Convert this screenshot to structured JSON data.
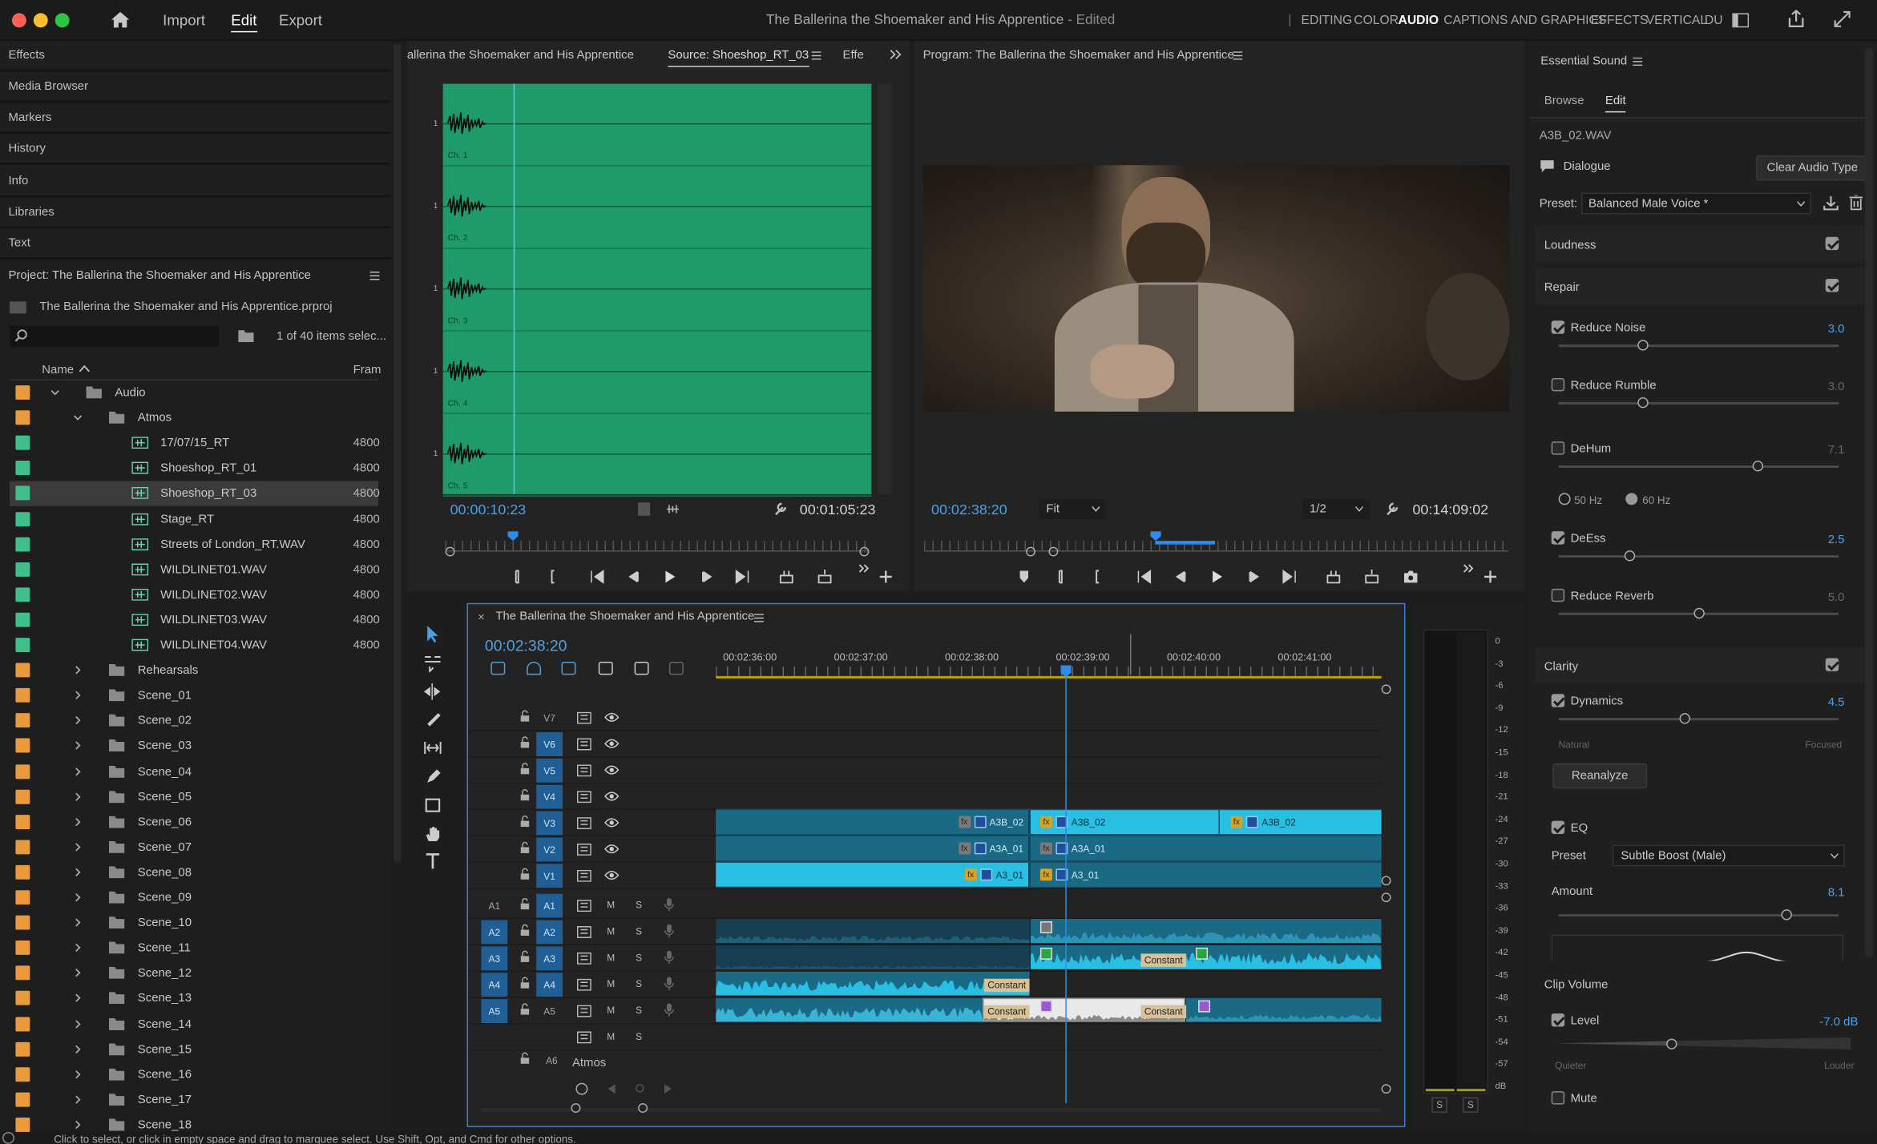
{
  "titlebar": {
    "home_icon": "home-icon",
    "menu": [
      "Import",
      "Edit",
      "Export"
    ],
    "active_menu": "Edit",
    "doc_title": "The Ballerina the Shoemaker and His Apprentice",
    "doc_status": "- Edited",
    "workspaces": [
      "EDITING",
      "COLOR",
      "AUDIO",
      "CAPTIONS AND GRAPHICS",
      "EFFECTS",
      "VERTICAL",
      "DU"
    ],
    "active_workspace": "AUDIO"
  },
  "left_tabs": [
    "Effects",
    "Media Browser",
    "Markers",
    "History",
    "Info",
    "Libraries",
    "Text"
  ],
  "project": {
    "title": "Project: The Ballerina the Shoemaker and His Apprentice",
    "file": "The Ballerina the Shoemaker and His Apprentice.prproj",
    "selection": "1 of 40 items selec...",
    "col_name": "Name",
    "col_frame": "Fram",
    "items": [
      {
        "label": "Audio",
        "type": "folder",
        "indent": 0,
        "open": true,
        "color": "#e89a3c",
        "rate": ""
      },
      {
        "label": "Atmos",
        "type": "folder",
        "indent": 1,
        "open": true,
        "color": "#e89a3c",
        "rate": ""
      },
      {
        "label": "17/07/15_RT",
        "type": "clip",
        "indent": 2,
        "color": "#3fc08a",
        "rate": "4800"
      },
      {
        "label": "Shoeshop_RT_01",
        "type": "clip",
        "indent": 2,
        "color": "#3fc08a",
        "rate": "4800"
      },
      {
        "label": "Shoeshop_RT_03",
        "type": "clip",
        "indent": 2,
        "color": "#3fc08a",
        "rate": "4800",
        "selected": true
      },
      {
        "label": "Stage_RT",
        "type": "clip",
        "indent": 2,
        "color": "#3fc08a",
        "rate": "4800"
      },
      {
        "label": "Streets of London_RT.WAV",
        "type": "clip",
        "indent": 2,
        "color": "#3fc08a",
        "rate": "4800"
      },
      {
        "label": "WILDLINET01.WAV",
        "type": "clip",
        "indent": 2,
        "color": "#3fc08a",
        "rate": "4800"
      },
      {
        "label": "WILDLINET02.WAV",
        "type": "clip",
        "indent": 2,
        "color": "#3fc08a",
        "rate": "4800"
      },
      {
        "label": "WILDLINET03.WAV",
        "type": "clip",
        "indent": 2,
        "color": "#3fc08a",
        "rate": "4800"
      },
      {
        "label": "WILDLINET04.WAV",
        "type": "clip",
        "indent": 2,
        "color": "#3fc08a",
        "rate": "4800"
      },
      {
        "label": "Rehearsals",
        "type": "folder",
        "indent": 1,
        "color": "#e89a3c",
        "rate": ""
      },
      {
        "label": "Scene_01",
        "type": "folder",
        "indent": 1,
        "color": "#e89a3c",
        "rate": ""
      },
      {
        "label": "Scene_02",
        "type": "folder",
        "indent": 1,
        "color": "#e89a3c",
        "rate": ""
      },
      {
        "label": "Scene_03",
        "type": "folder",
        "indent": 1,
        "color": "#e89a3c",
        "rate": ""
      },
      {
        "label": "Scene_04",
        "type": "folder",
        "indent": 1,
        "color": "#e89a3c",
        "rate": ""
      },
      {
        "label": "Scene_05",
        "type": "folder",
        "indent": 1,
        "color": "#e89a3c",
        "rate": ""
      },
      {
        "label": "Scene_06",
        "type": "folder",
        "indent": 1,
        "color": "#e89a3c",
        "rate": ""
      },
      {
        "label": "Scene_07",
        "type": "folder",
        "indent": 1,
        "color": "#e89a3c",
        "rate": ""
      },
      {
        "label": "Scene_08",
        "type": "folder",
        "indent": 1,
        "color": "#e89a3c",
        "rate": ""
      },
      {
        "label": "Scene_09",
        "type": "folder",
        "indent": 1,
        "color": "#e89a3c",
        "rate": ""
      },
      {
        "label": "Scene_10",
        "type": "folder",
        "indent": 1,
        "color": "#e89a3c",
        "rate": ""
      },
      {
        "label": "Scene_11",
        "type": "folder",
        "indent": 1,
        "color": "#e89a3c",
        "rate": ""
      },
      {
        "label": "Scene_12",
        "type": "folder",
        "indent": 1,
        "color": "#e89a3c",
        "rate": ""
      },
      {
        "label": "Scene_13",
        "type": "folder",
        "indent": 1,
        "color": "#e89a3c",
        "rate": ""
      },
      {
        "label": "Scene_14",
        "type": "folder",
        "indent": 1,
        "color": "#e89a3c",
        "rate": ""
      },
      {
        "label": "Scene_15",
        "type": "folder",
        "indent": 1,
        "color": "#e89a3c",
        "rate": ""
      },
      {
        "label": "Scene_16",
        "type": "folder",
        "indent": 1,
        "color": "#e89a3c",
        "rate": ""
      },
      {
        "label": "Scene_17",
        "type": "folder",
        "indent": 1,
        "color": "#e89a3c",
        "rate": ""
      },
      {
        "label": "Scene_18",
        "type": "folder",
        "indent": 1,
        "color": "#e89a3c",
        "rate": ""
      }
    ]
  },
  "source": {
    "tabs": [
      "allerina the Shoemaker and His Apprentice",
      "Source: Shoeshop_RT_03",
      "Effe"
    ],
    "channels": [
      "Ch. 1",
      "Ch. 2",
      "Ch. 3",
      "Ch. 4",
      "Ch. 5"
    ],
    "channel_tick": "1",
    "tc_in": "00:00:10:23",
    "tc_dur": "00:01:05:23"
  },
  "program": {
    "title": "Program: The Ballerina the Shoemaker and His Apprentice",
    "tc": "00:02:38:20",
    "fit": "Fit",
    "res": "1/2",
    "dur": "00:14:09:02"
  },
  "timeline": {
    "title": "The Ballerina the Shoemaker and His Apprentice",
    "tc": "00:02:38:20",
    "ruler": [
      "00:02:36:00",
      "00:02:37:00",
      "00:02:38:00",
      "00:02:39:00",
      "00:02:40:00",
      "00:02:41:00"
    ],
    "video_tracks": [
      "V7",
      "V6",
      "V5",
      "V4",
      "V3",
      "V2",
      "V1"
    ],
    "audio_tracks": [
      {
        "src": "A1",
        "tgt": "A1"
      },
      {
        "src": "A2",
        "tgt": "A2"
      },
      {
        "src": "A3",
        "tgt": "A3"
      },
      {
        "src": "A4",
        "tgt": "A4"
      },
      {
        "src": "A5",
        "tgt": "A5"
      },
      {
        "src": "",
        "tgt": ""
      }
    ],
    "mix_label": "A6",
    "atmos": "Atmos",
    "m": "M",
    "s": "S",
    "clips": {
      "a3b1": "A3B_02",
      "a3b2": "A3B_02",
      "a3b3": "A3B_02",
      "a3a1": "A3A_01",
      "a3a2": "A3A_01",
      "a31": "A3_01",
      "a32": "A3_01"
    },
    "constant": "Constant"
  },
  "meter": {
    "scale": [
      "0",
      "-3",
      "-6",
      "-9",
      "-12",
      "-15",
      "-18",
      "-21",
      "-24",
      "-27",
      "-30",
      "-33",
      "-36",
      "-39",
      "-42",
      "-45",
      "-48",
      "-51",
      "-54",
      "-57",
      "dB"
    ],
    "solo": "S"
  },
  "essential": {
    "title": "Essential Sound",
    "tabs": [
      "Browse",
      "Edit"
    ],
    "active_tab": "Edit",
    "clip": "A3B_02.WAV",
    "type": "Dialogue",
    "clear": "Clear Audio Type",
    "preset_label": "Preset:",
    "preset": "Balanced Male Voice *",
    "loudness": "Loudness",
    "repair": "Repair",
    "reduce_noise": {
      "label": "Reduce Noise",
      "value": "3.0",
      "on": true,
      "level": 0.3
    },
    "reduce_rumble": {
      "label": "Reduce Rumble",
      "value": "3.0",
      "on": false,
      "level": 0.3
    },
    "dehum": {
      "label": "DeHum",
      "value": "7.1",
      "on": false,
      "level": 0.71
    },
    "hz50": "50 Hz",
    "hz60": "60 Hz",
    "deess": {
      "label": "DeEss",
      "value": "2.5",
      "on": true,
      "level": 0.25
    },
    "reduce_reverb": {
      "label": "Reduce Reverb",
      "value": "5.0",
      "on": false,
      "level": 0.5
    },
    "clarity": "Clarity",
    "dynamics": {
      "label": "Dynamics",
      "value": "4.5",
      "on": true,
      "level": 0.45,
      "left": "Natural",
      "right": "Focused"
    },
    "reanalyze": "Reanalyze",
    "eq": {
      "label": "EQ",
      "on": true,
      "preset_label": "Preset",
      "preset": "Subtle Boost (Male)",
      "amount_label": "Amount",
      "amount": "8.1",
      "level": 0.81
    },
    "clip_volume": "Clip Volume",
    "level": {
      "label": "Level",
      "value": "-7.0 dB",
      "on": true,
      "level": 0.4,
      "left": "Quieter",
      "right": "Louder"
    },
    "mute": "Mute"
  },
  "status": "Click to select, or click in empty space and drag to marquee select. Use Shift, Opt, and Cmd for other options."
}
